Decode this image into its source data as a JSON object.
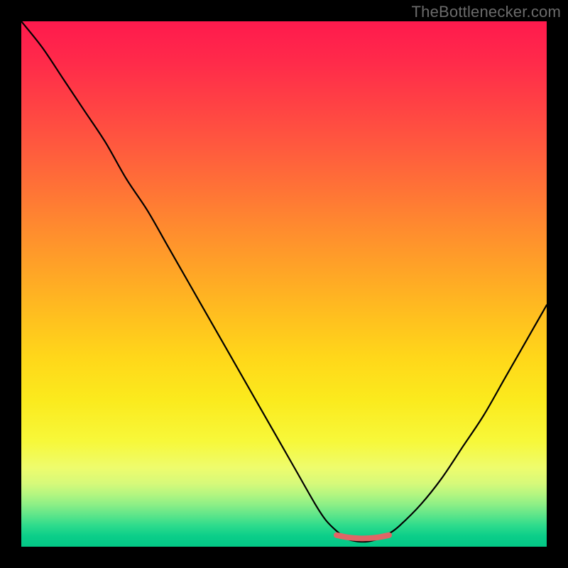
{
  "watermark": "TheBottlenecker.com",
  "chart_data": {
    "type": "line",
    "title": "",
    "xlabel": "",
    "ylabel": "",
    "xlim": [
      0,
      100
    ],
    "ylim": [
      0,
      100
    ],
    "series": [
      {
        "name": "bottleneck-curve",
        "x": [
          0,
          4,
          8,
          12,
          16,
          20,
          24,
          28,
          32,
          36,
          40,
          44,
          48,
          52,
          56,
          58,
          60,
          62,
          64,
          66,
          68,
          70,
          72,
          76,
          80,
          84,
          88,
          92,
          96,
          100
        ],
        "values": [
          100,
          95,
          89,
          83,
          77,
          70,
          64,
          57,
          50,
          43,
          36,
          29,
          22,
          15,
          8,
          5,
          3,
          1.5,
          1,
          1,
          1.5,
          2.5,
          4,
          8,
          13,
          19,
          25,
          32,
          39,
          46
        ]
      },
      {
        "name": "optimal-marker",
        "x": [
          60,
          62,
          64,
          66,
          68,
          70
        ],
        "values": [
          2.2,
          1.8,
          1.6,
          1.6,
          1.8,
          2.2
        ]
      }
    ],
    "gradient_stops": [
      {
        "pos": 0,
        "color": "#ff1a4d"
      },
      {
        "pos": 25,
        "color": "#ff5a3e"
      },
      {
        "pos": 50,
        "color": "#ffbf1f"
      },
      {
        "pos": 80,
        "color": "#f7f83a"
      },
      {
        "pos": 100,
        "color": "#03c786"
      }
    ]
  }
}
